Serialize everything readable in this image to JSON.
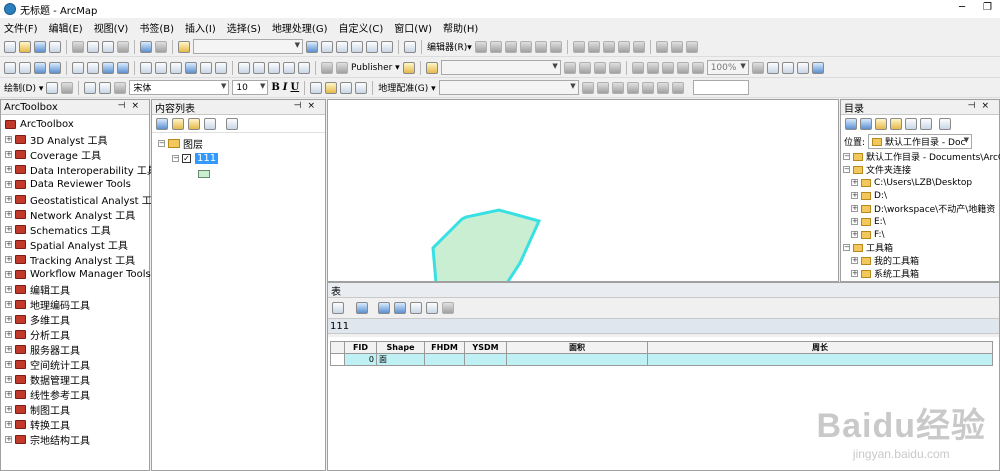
{
  "window": {
    "title": "无标题 - ArcMap",
    "minimize": "─",
    "restore": "❐"
  },
  "menu": [
    "文件(F)",
    "编辑(E)",
    "视图(V)",
    "书签(B)",
    "插入(I)",
    "选择(S)",
    "地理处理(G)",
    "自定义(C)",
    "窗口(W)",
    "帮助(H)"
  ],
  "toolbar1": {
    "editor_label": "编辑器(R)▾"
  },
  "toolbar2": {
    "publisher_label": "Publisher ▾",
    "zoom_value": "100%"
  },
  "toolbar3": {
    "draw_label": "绘制(D) ▾",
    "font_value": "宋体",
    "font_size": "10",
    "bold": "B",
    "italic": "I",
    "underline": "U",
    "georef_label": "地理配准(G) ▾"
  },
  "toolbox": {
    "title": "ArcToolbox",
    "root": "ArcToolbox",
    "items": [
      "3D Analyst 工具",
      "Coverage 工具",
      "Data Interoperability 工具",
      "Data Reviewer Tools",
      "Geostatistical Analyst 工具",
      "Network Analyst 工具",
      "Schematics 工具",
      "Spatial Analyst 工具",
      "Tracking Analyst 工具",
      "Workflow Manager Tools",
      "编辑工具",
      "地理编码工具",
      "多维工具",
      "分析工具",
      "服务器工具",
      "空间统计工具",
      "数据管理工具",
      "线性参考工具",
      "制图工具",
      "转换工具",
      "宗地结构工具"
    ]
  },
  "toc": {
    "title": "内容列表",
    "layers_group": "图层",
    "layer_name": "111",
    "layer_checked": "✓"
  },
  "catalog": {
    "title": "目录",
    "location_label": "位置:",
    "location_value": "默认工作目录 - Doc",
    "items": [
      {
        "label": "默认工作目录 - Documents\\ArcG",
        "indent": 0
      },
      {
        "label": "文件夹连接",
        "indent": 0
      },
      {
        "label": "C:\\Users\\LZB\\Desktop",
        "indent": 1
      },
      {
        "label": "D:\\",
        "indent": 1
      },
      {
        "label": "D:\\workspace\\不动产\\地籍资",
        "indent": 1
      },
      {
        "label": "E:\\",
        "indent": 1
      },
      {
        "label": "F:\\",
        "indent": 1
      },
      {
        "label": "工具箱",
        "indent": 0
      },
      {
        "label": "我的工具箱",
        "indent": 1
      },
      {
        "label": "系统工具箱",
        "indent": 1
      }
    ]
  },
  "table": {
    "title": "表",
    "name": "111",
    "columns": [
      "FID",
      "Shape",
      "FHDM",
      "YSDM",
      "面积",
      "周长"
    ],
    "rows": [
      [
        "0",
        "面",
        "",
        "",
        "",
        ""
      ]
    ]
  },
  "colors": {
    "polygon_fill": "#c9eed2",
    "polygon_stroke": "#38e0e3",
    "row_highlight": "#bff0f4"
  },
  "watermark": {
    "brand": "Baidu经验",
    "url": "jingyan.baidu.com"
  }
}
